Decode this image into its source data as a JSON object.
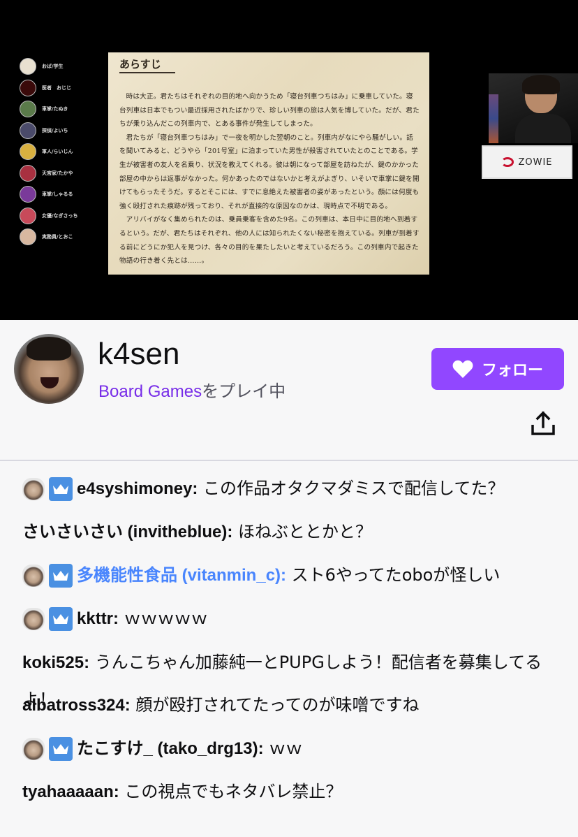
{
  "stream": {
    "players": [
      {
        "name": "おば/学生",
        "color": "#e8e0d0"
      },
      {
        "name": "医者　おじじ",
        "color": "#3a0a0a"
      },
      {
        "name": "車掌/たぬき",
        "color": "#5a7a4a"
      },
      {
        "name": "探偵/よいち",
        "color": "#4a4a6a"
      },
      {
        "name": "軍人/らいじん",
        "color": "#d8b040"
      },
      {
        "name": "天宮家/たかや",
        "color": "#a83040"
      },
      {
        "name": "車掌/しゃるる",
        "color": "#7a3a9a"
      },
      {
        "name": "女優/なぎさっち",
        "color": "#c84a5a"
      },
      {
        "name": "実務員/とおこ",
        "color": "#d8b8a0"
      }
    ],
    "document": {
      "title": "あらすじ",
      "paragraphs": [
        "時は大正。君たちはそれぞれの目的地へ向かうため「寝台列車つちはみ」に乗車していた。寝台列車は日本でもつい最近採用されたばかりで、珍しい列車の旅は人気を博していた。だが、君たちが乗り込んだこの列車内で、とある事件が発生してしまった。",
        "君たちが「寝台列車つちはみ」で一夜を明かした翌朝のこと。列車内がなにやら騒がしい。話を聞いてみると、どうやら「201号室」に泊まっていた男性が殺害されていたとのことである。学生が被害者の友人を名乗り、状況を教えてくれる。彼は朝になって部屋を訪ねたが、鍵のかかった部屋の中からは返事がなかった。何かあったのではないかと考えがよぎり、いそいで車掌に鍵を開けてもらったそうだ。するとそこには、すでに息絶えた被害者の姿があったという。顔には何度も強く殴打された痕跡が残っており、それが直接的な原因なのかは、現時点で不明である。",
        "アリバイがなく集められたのは、乗員乗客を含めた9名。この列車は、本日中に目的地へ到着するという。だが、君たちはそれぞれ、他の人には知られたくない秘密を抱えている。列車が到着する前にどうにか犯人を見つけ、各々の目的を果たしたいと考えているだろう。この列車内で起きた物語の行き着く先とは……。"
      ]
    },
    "sponsor": "ZOWIE"
  },
  "channel": {
    "name": "k4sen",
    "game": "Board Games",
    "playing_suffix": "をプレイ中",
    "follow_label": "フォロー",
    "colors": {
      "follow_bg": "#9147ff",
      "game_link": "#772ce8"
    }
  },
  "chat": [
    {
      "user": "e4syshimoney:",
      "text": " この作品オタクマダミスで配信してた？",
      "badges": true,
      "blue": false
    },
    {
      "user": "さいさいさい (invitheblue):",
      "text": " ほねぶととかと？",
      "badges": false,
      "blue": false
    },
    {
      "user": "多機能性食品 (vitanmin_c):",
      "text": " スト6やってたoboが怪しい",
      "badges": true,
      "blue": true
    },
    {
      "user": "kkttr:",
      "text": " ｗｗｗｗｗ",
      "badges": true,
      "blue": false
    },
    {
      "user": "koki525:",
      "text": " うんこちゃん加藤純一とPUPGしよう！配信者を募集してるよ！",
      "badges": false,
      "blue": false
    },
    {
      "user": "albatross324:",
      "text": " 顔が殴打されてたってのが味噌ですね",
      "badges": false,
      "blue": false
    },
    {
      "user": "たこすけ_ (tako_drg13):",
      "text": " ｗｗ",
      "badges": true,
      "blue": false
    },
    {
      "user": "tyahaaaaan:",
      "text": " この視点でもネタバレ禁止？",
      "badges": false,
      "blue": false
    }
  ]
}
